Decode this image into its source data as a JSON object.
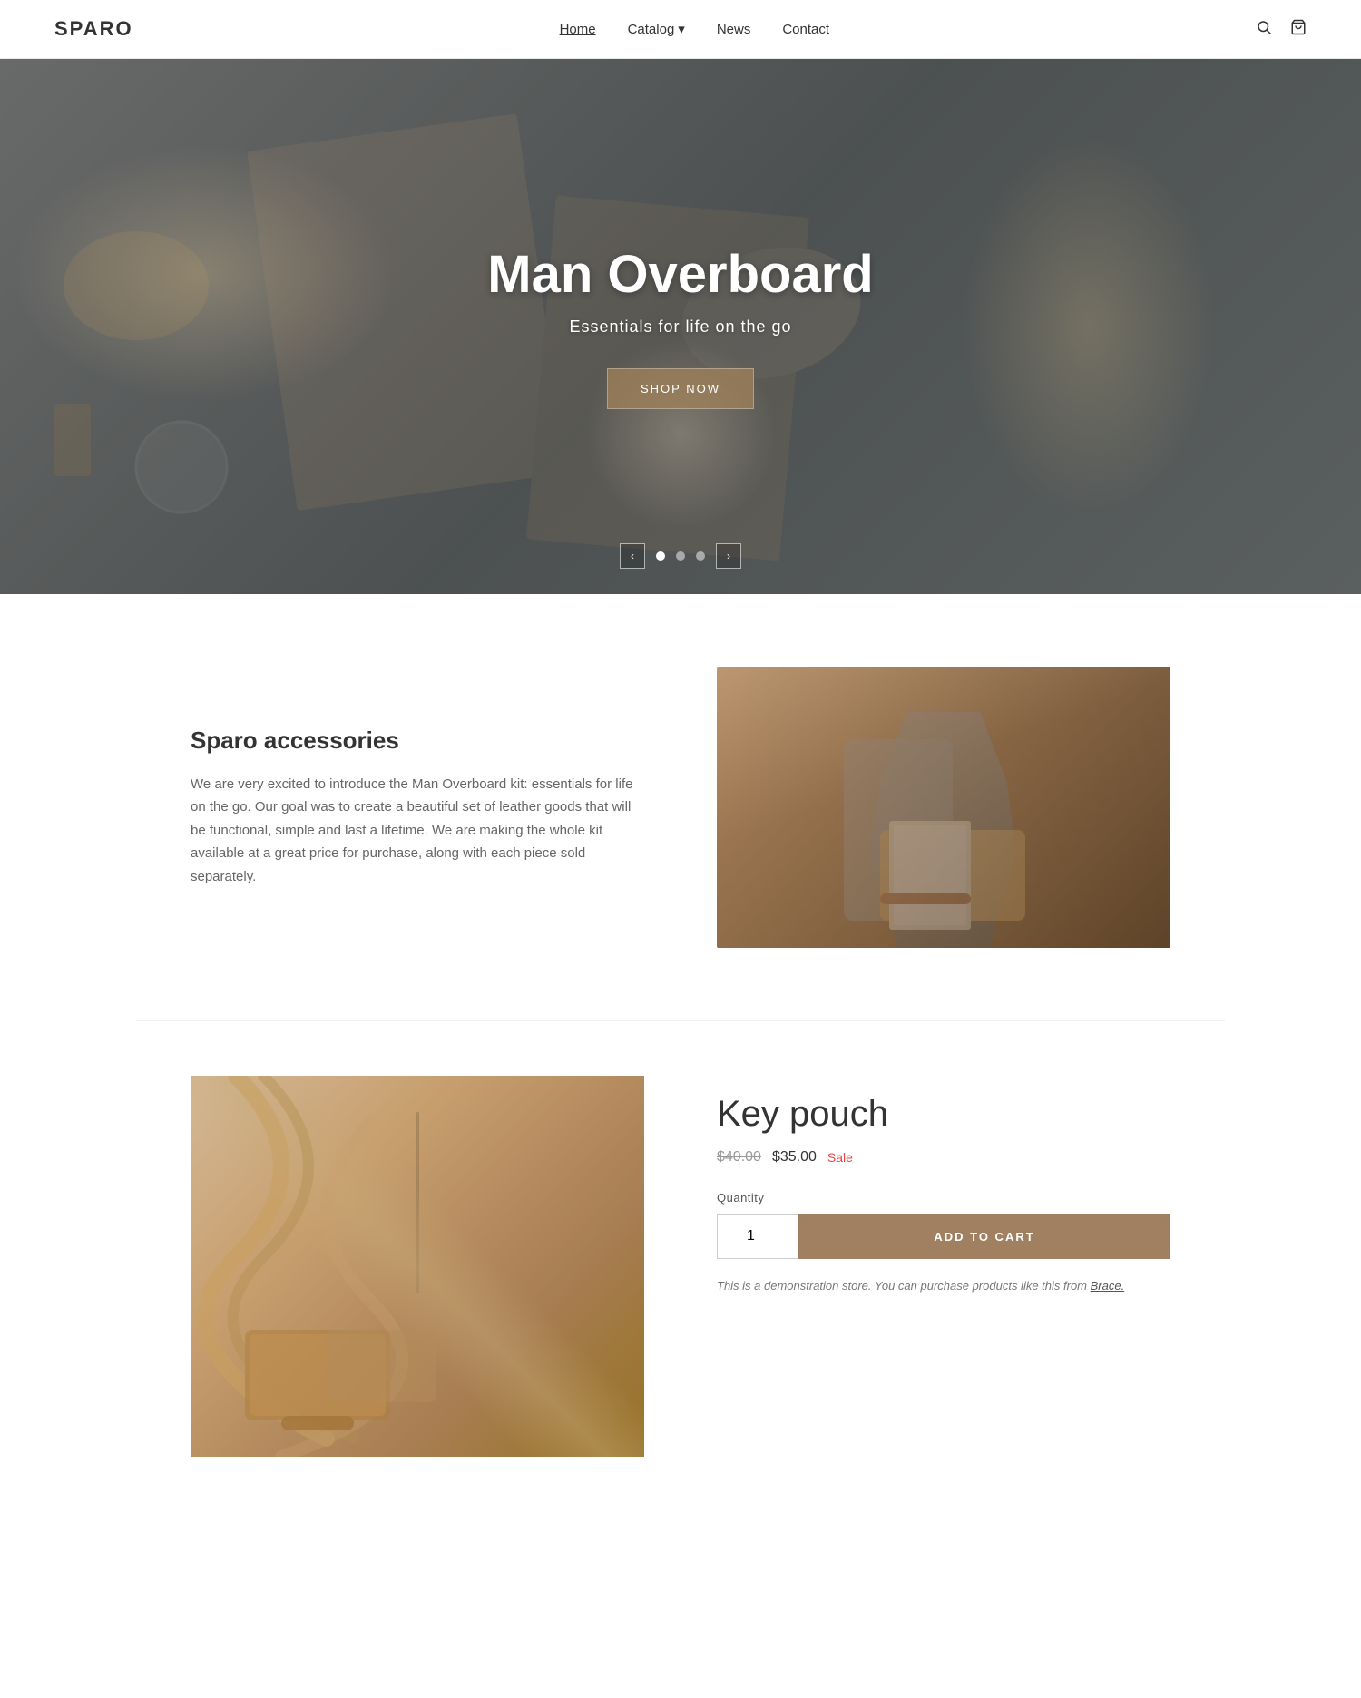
{
  "header": {
    "logo": "SPARO",
    "nav": {
      "home": "Home",
      "catalog": "Catalog",
      "news": "News",
      "contact": "Contact"
    },
    "icons": {
      "search": "search-icon",
      "cart": "cart-icon"
    }
  },
  "hero": {
    "title": "Man Overboard",
    "subtitle": "Essentials for life on the go",
    "cta": "SHOP NOW",
    "prev_label": "‹",
    "next_label": "›",
    "slides_total": 3,
    "active_slide": 1
  },
  "accessories": {
    "heading": "Sparo accessories",
    "body": "We are very excited to introduce the Man Overboard kit: essentials for life on the go. Our goal was to create a beautiful set of leather goods that will be functional, simple and last a lifetime. We are making the whole kit available at a great price for purchase, along with each piece sold separately."
  },
  "product": {
    "title": "Key pouch",
    "price_original": "$40.00",
    "price_sale": "$35.00",
    "price_badge": "Sale",
    "quantity_label": "Quantity",
    "quantity_value": "1",
    "add_to_cart": "ADD TO CART",
    "demo_note": "This is a demonstration store. You can purchase products like this from",
    "demo_link_text": "Brace.",
    "demo_link_url": "#"
  }
}
